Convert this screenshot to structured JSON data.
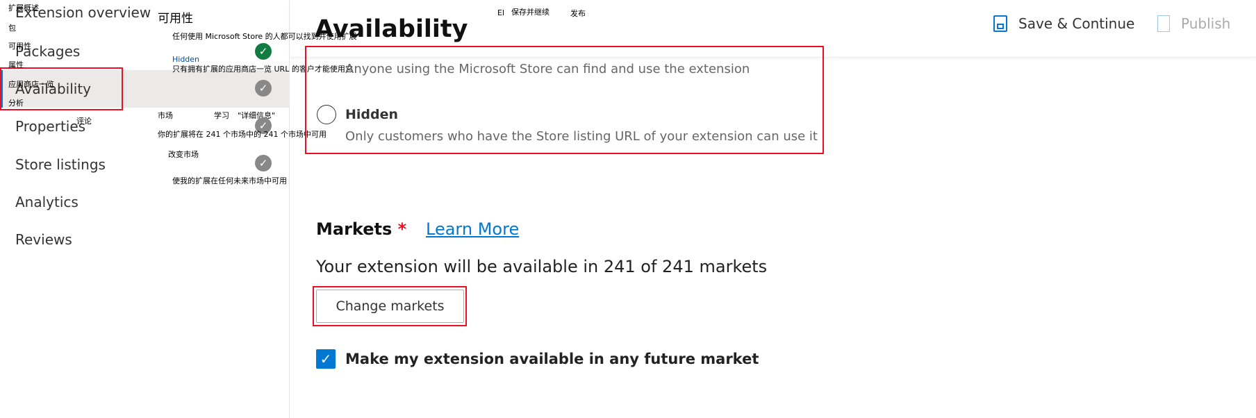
{
  "sidebar": {
    "items": [
      {
        "label": "Extension overview",
        "zh": "扩展概述"
      },
      {
        "label": "Packages",
        "zh": "包"
      },
      {
        "label": "Availability",
        "zh": "可用性"
      },
      {
        "label": "Properties",
        "zh": "属性"
      },
      {
        "label": "Store listings",
        "zh": "应用商店一览"
      },
      {
        "label": "Analytics",
        "zh": "分析"
      },
      {
        "label": "Reviews",
        "zh": "评论"
      }
    ],
    "active": "Availability"
  },
  "header": {
    "save_label": "Save & Continue",
    "publish_label": "Publish",
    "save_zh": "保存并继续",
    "publish_zh": "发布",
    "el": "El"
  },
  "page": {
    "title": "Availability",
    "title_zh": "可用性"
  },
  "visibility": {
    "public_desc": "Anyone using the Microsoft Store can find and use the extension",
    "public_desc_zh": "任何使用 Microsoft Store 的人都可以找到并使用扩展",
    "hidden_label": "Hidden",
    "hidden_label_zh": "Hidden",
    "hidden_desc": "Only customers who have the Store listing URL of your extension can use it",
    "hidden_desc_zh": "只有拥有扩展的应用商店一览 URL 的客户才能使用它"
  },
  "markets": {
    "label": "Markets",
    "required": "*",
    "learn_more": "Learn More",
    "label_zh": "市场",
    "learn_zh": "学习",
    "more_zh": "\"详细信息\"",
    "summary": "Your extension will be available in 241 of 241 markets",
    "summary_zh": "你的扩展将在 241 个市场中的 241 个市场中可用",
    "change_button": "Change markets",
    "change_zh": "改变市场",
    "future_label": "Make my extension available in any future market",
    "future_zh": "使我的扩展在任何未来市场中可用",
    "future_checked": true
  },
  "colors": {
    "accent": "#0078d4",
    "highlight": "#e81123",
    "check_green": "#107c41",
    "check_gray": "#888888"
  }
}
